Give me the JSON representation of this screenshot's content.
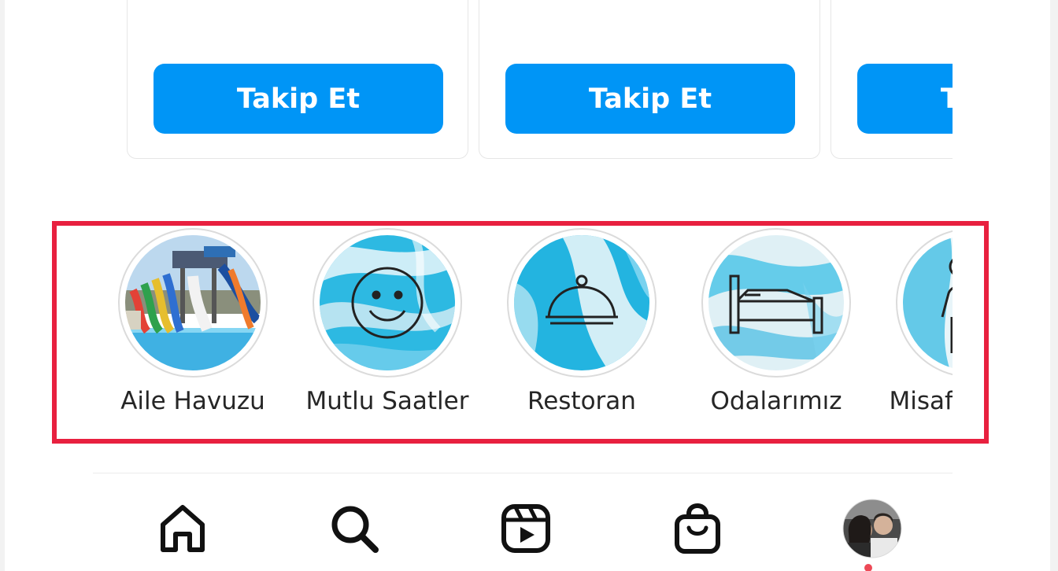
{
  "suggestions": [
    {
      "follow_label": "Takip Et"
    },
    {
      "follow_label": "Takip Et"
    },
    {
      "follow_label": "Takip Et"
    }
  ],
  "highlights": [
    {
      "label": "Aile Havuzu",
      "icon": "water-park-photo"
    },
    {
      "label": "Mutlu Saatler",
      "icon": "smiley-icon"
    },
    {
      "label": "Restoran",
      "icon": "cloche-icon"
    },
    {
      "label": "Odalarımız",
      "icon": "bed-icon"
    },
    {
      "label": "Misafirlerimiz",
      "icon": "person-icon"
    }
  ],
  "bottom_nav": [
    {
      "name": "home",
      "icon": "home-icon"
    },
    {
      "name": "search",
      "icon": "search-icon"
    },
    {
      "name": "reels",
      "icon": "reels-icon"
    },
    {
      "name": "shop",
      "icon": "shopping-bag-icon"
    },
    {
      "name": "profile",
      "icon": "profile-avatar"
    }
  ],
  "colors": {
    "accent": "#0095f6",
    "highlight_frame": "#e8203f",
    "marble": "#29b6df",
    "notification": "#ed4956"
  }
}
